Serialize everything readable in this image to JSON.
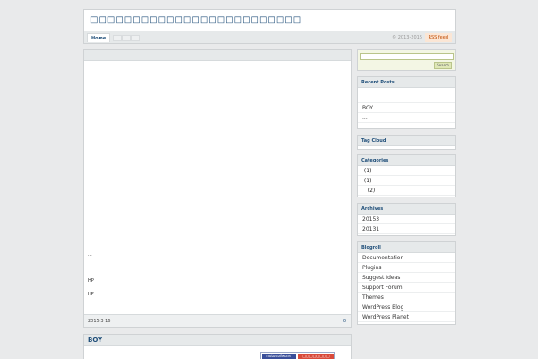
{
  "header": {
    "site_title": "□□□□□□□□□□□□□□□□□□□□□□□□□",
    "nav": {
      "home": "Home",
      "copyright": "© 2013-2015",
      "rss": "RSS feed"
    }
  },
  "main_post": {
    "lines": [
      "...",
      "HP",
      "HP"
    ],
    "date": "2015 3 16",
    "comments": "0"
  },
  "second_post": {
    "title": "BOY",
    "image_left_text": "nobusoftware",
    "image_right_text": "□□□□□□□□"
  },
  "sidebar": {
    "search": {
      "placeholder": "",
      "button": "Search"
    },
    "recent_posts": {
      "title": "Recent Posts",
      "items": [
        "",
        "BOY",
        "..."
      ]
    },
    "tag_cloud": {
      "title": "Tag Cloud"
    },
    "categories": {
      "title": "Categories",
      "items": [
        " (1)",
        " (1)",
        "   (2)"
      ]
    },
    "archives": {
      "title": "Archives",
      "items": [
        "20153",
        "20131"
      ]
    },
    "blogroll": {
      "title": "Blogroll",
      "items": [
        "Documentation",
        "Plugins",
        "Suggest Ideas",
        "Support Forum",
        "Themes",
        "WordPress Blog",
        "WordPress Planet"
      ]
    }
  }
}
